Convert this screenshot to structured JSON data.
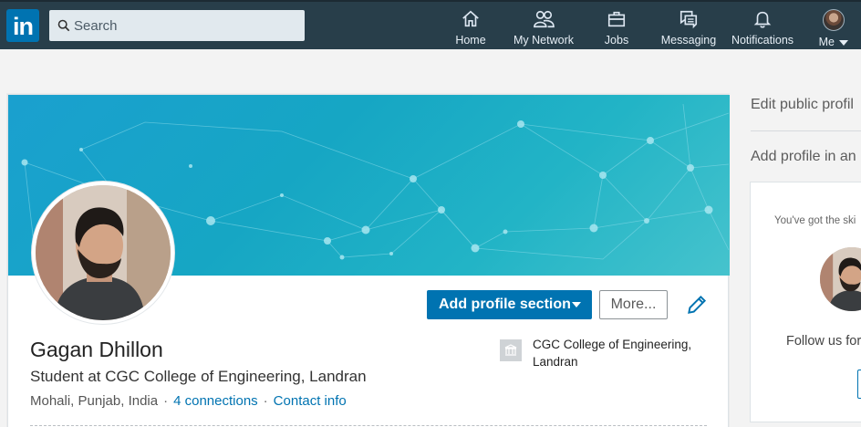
{
  "nav": {
    "logo": "in",
    "search_placeholder": "Search",
    "items": [
      {
        "label": "Home"
      },
      {
        "label": "My Network"
      },
      {
        "label": "Jobs"
      },
      {
        "label": "Messaging"
      },
      {
        "label": "Notifications"
      },
      {
        "label": "Me"
      }
    ]
  },
  "profile": {
    "name": "Gagan Dhillon",
    "headline": "Student at CGC College of Engineering, Landran",
    "location": "Mohali, Punjab, India",
    "connections": "4 connections",
    "contact": "Contact info",
    "school": "CGC College of Engineering, Landran",
    "add_section_label": "Add profile section",
    "more_label": "More..."
  },
  "rail": {
    "edit_public_profile": "Edit public profil",
    "add_profile_language": "Add profile in an",
    "card_text": "You've got the ski",
    "follow_text": "Follow us for"
  },
  "colors": {
    "nav_bg": "#283e4a",
    "brand_blue": "#0073b1",
    "banner_teal": "#1aa0cf"
  },
  "icons": {
    "logo": "linkedin-logo",
    "search": "search-icon",
    "home": "home-icon",
    "network": "people-icon",
    "jobs": "briefcase-icon",
    "messaging": "chat-icon",
    "notifications": "bell-icon",
    "edit": "pencil-icon",
    "school": "school-icon"
  }
}
